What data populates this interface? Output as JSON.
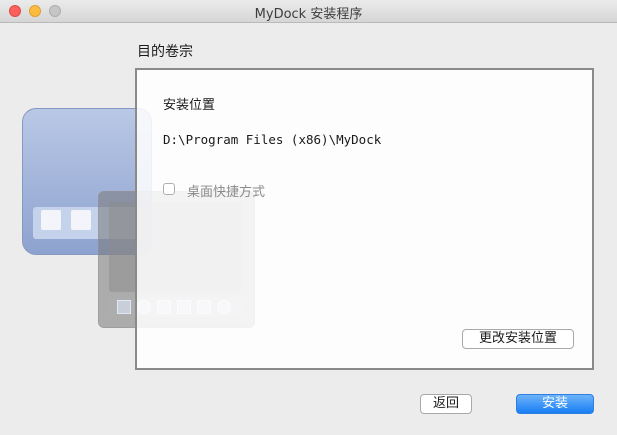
{
  "window": {
    "title": "MyDock 安装程序"
  },
  "section": {
    "heading": "目的卷宗"
  },
  "panel": {
    "location_label": "安装位置",
    "install_path": "D:\\Program Files (x86)\\MyDock",
    "shortcut_checkbox": {
      "label": "桌面快捷方式",
      "checked": false
    },
    "change_location_button": "更改安装位置"
  },
  "footer": {
    "back_button": "返回",
    "install_button": "安装"
  },
  "colors": {
    "accent": "#1a80f5",
    "close": "#fc605c",
    "minimize": "#fdbc40",
    "zoom_disabled": "#c6c6c6"
  }
}
